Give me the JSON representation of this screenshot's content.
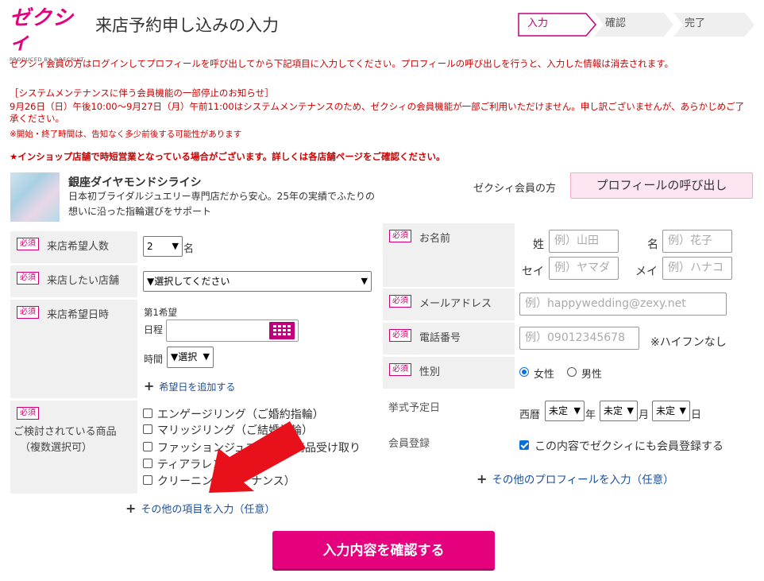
{
  "brand": {
    "logo_text": "ゼクシィ",
    "logo_sub": "PRODUCED BY ®RECRUIT",
    "accent": "#e4007f"
  },
  "header": {
    "title": "来店予約申し込みの入力"
  },
  "steps": [
    {
      "label": "入力",
      "active": true
    },
    {
      "label": "確認",
      "active": false
    },
    {
      "label": "完了",
      "active": false
    }
  ],
  "notices": {
    "login": "ゼクシィ会員の方はログインしてプロフィールを呼び出してから下記項目に入力してください。プロフィールの呼び出しを行うと、入力した情報は消去されます。",
    "maintenance_title": "［システムメンテナンスに伴う会員機能の一部停止のお知らせ］",
    "maintenance_body": "9月26日（日）午後10:00～9月27日（月）午前11:00はシステムメンテナンスのため、ゼクシィの会員機能が一部ご利用いただけません。申し訳ございませんが、あらかじめご了承ください。",
    "maintenance_note": "※開始・終了時間は、告知なく多少前後する可能性があります",
    "instore": "★インショップ店舗で時短営業となっている場合がございます。詳しくは各店舗ページをご確認ください。"
  },
  "shop": {
    "name": "銀座ダイヤモンドシライシ",
    "desc": "日本初ブライダルジュエリー専門店だから安心。25年の実績でふたりの想いに沿った指輪選びをサポート"
  },
  "member": {
    "label": "ゼクシィ会員の方",
    "profile_button": "プロフィールの呼び出し"
  },
  "required_badge": "必須",
  "form_left": {
    "people": {
      "label": "来店希望人数",
      "value": "2",
      "unit": "名"
    },
    "store": {
      "label": "来店したい店舗",
      "value": "▼選択してください"
    },
    "date": {
      "label": "来店希望日時",
      "first_choice": "第1希望",
      "date_label": "日程",
      "time_label": "時間",
      "time_value": "▼選択",
      "add_link": "希望日を追加する"
    },
    "products": {
      "label": "ご検討されている商品（複数選択可）",
      "label_line1": "ご検討されている商品",
      "label_line2": "（複数選択可）",
      "items": [
        "エンゲージリング（ご婚約指輪）",
        "マリッジリング（ご結婚指輪）",
        "ファッションジュエリー商品受け取り",
        "ティアラレンタル",
        "クリーニング（メンテナンス）"
      ],
      "item_display": [
        "エンゲージリング（ご婚約指輪）",
        "マリッジリング（ご結婚指輪）",
        "ファッションジュエリ",
        "商品受け取り",
        "ティアラレンタ",
        "クリーニング",
        "ナンス）"
      ]
    },
    "other_link": "その他の項目を入力（任意）"
  },
  "form_right": {
    "name": {
      "label": "お名前",
      "sei_label": "姓",
      "sei_placeholder": "例）山田",
      "mei_label": "名",
      "mei_placeholder": "例）花子",
      "sei_kana_label": "セイ",
      "sei_kana_placeholder": "例）ヤマダ",
      "mei_kana_label": "メイ",
      "mei_kana_placeholder": "例）ハナコ"
    },
    "email": {
      "label": "メールアドレス",
      "placeholder": "例）happywedding@zexy.net"
    },
    "phone": {
      "label": "電話番号",
      "placeholder": "例）09012345678",
      "note": "※ハイフンなし"
    },
    "gender": {
      "label": "性別",
      "options": [
        "女性",
        "男性"
      ],
      "selected": "女性"
    },
    "wedding_date": {
      "label": "挙式予定日",
      "era": "西暦",
      "year": "未定",
      "year_unit": "年",
      "month": "未定",
      "month_unit": "月",
      "day": "未定",
      "day_unit": "日"
    },
    "membership": {
      "label": "会員登録",
      "checkbox_label": "この内容でゼクシィにも会員登録する",
      "checked": true
    },
    "other_profile_link": "その他のプロフィールを入力（任意）"
  },
  "confirm_button": "入力内容を確認する",
  "annotation": {
    "color": "#e8101a"
  }
}
